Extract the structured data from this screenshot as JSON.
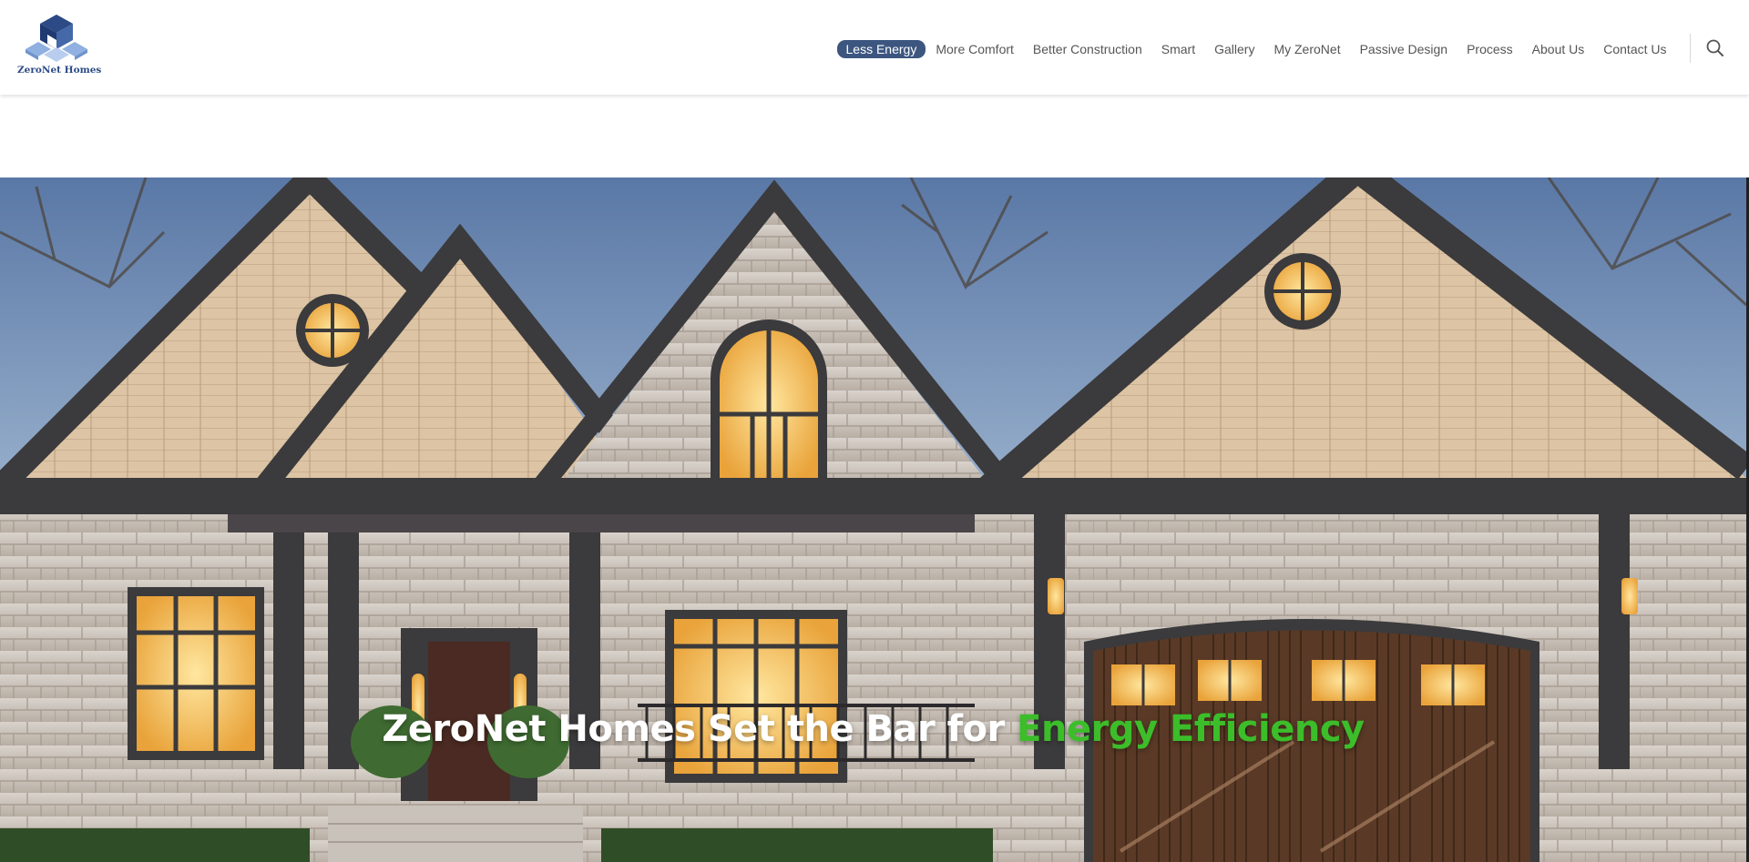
{
  "brand": {
    "name": "ZeroNet Homes"
  },
  "nav": {
    "items": [
      {
        "label": "Less Energy",
        "active": true
      },
      {
        "label": "More Comfort",
        "active": false
      },
      {
        "label": "Better Construction",
        "active": false
      },
      {
        "label": "Smart",
        "active": false
      },
      {
        "label": "Gallery",
        "active": false
      },
      {
        "label": "My ZeroNet",
        "active": false
      },
      {
        "label": "Passive Design",
        "active": false
      },
      {
        "label": "Process",
        "active": false
      },
      {
        "label": "About Us",
        "active": false
      },
      {
        "label": "Contact Us",
        "active": false
      }
    ],
    "search_icon": "search-icon"
  },
  "hero": {
    "headline_main": "ZeroNet Homes Set the Bar for ",
    "headline_highlight": "Energy Efficiency",
    "image": "house-exterior-photo"
  },
  "colors": {
    "accent": "#3c5680",
    "highlight": "#3cbd2a",
    "brand": "#2c4a86",
    "nav_text": "#555555"
  }
}
